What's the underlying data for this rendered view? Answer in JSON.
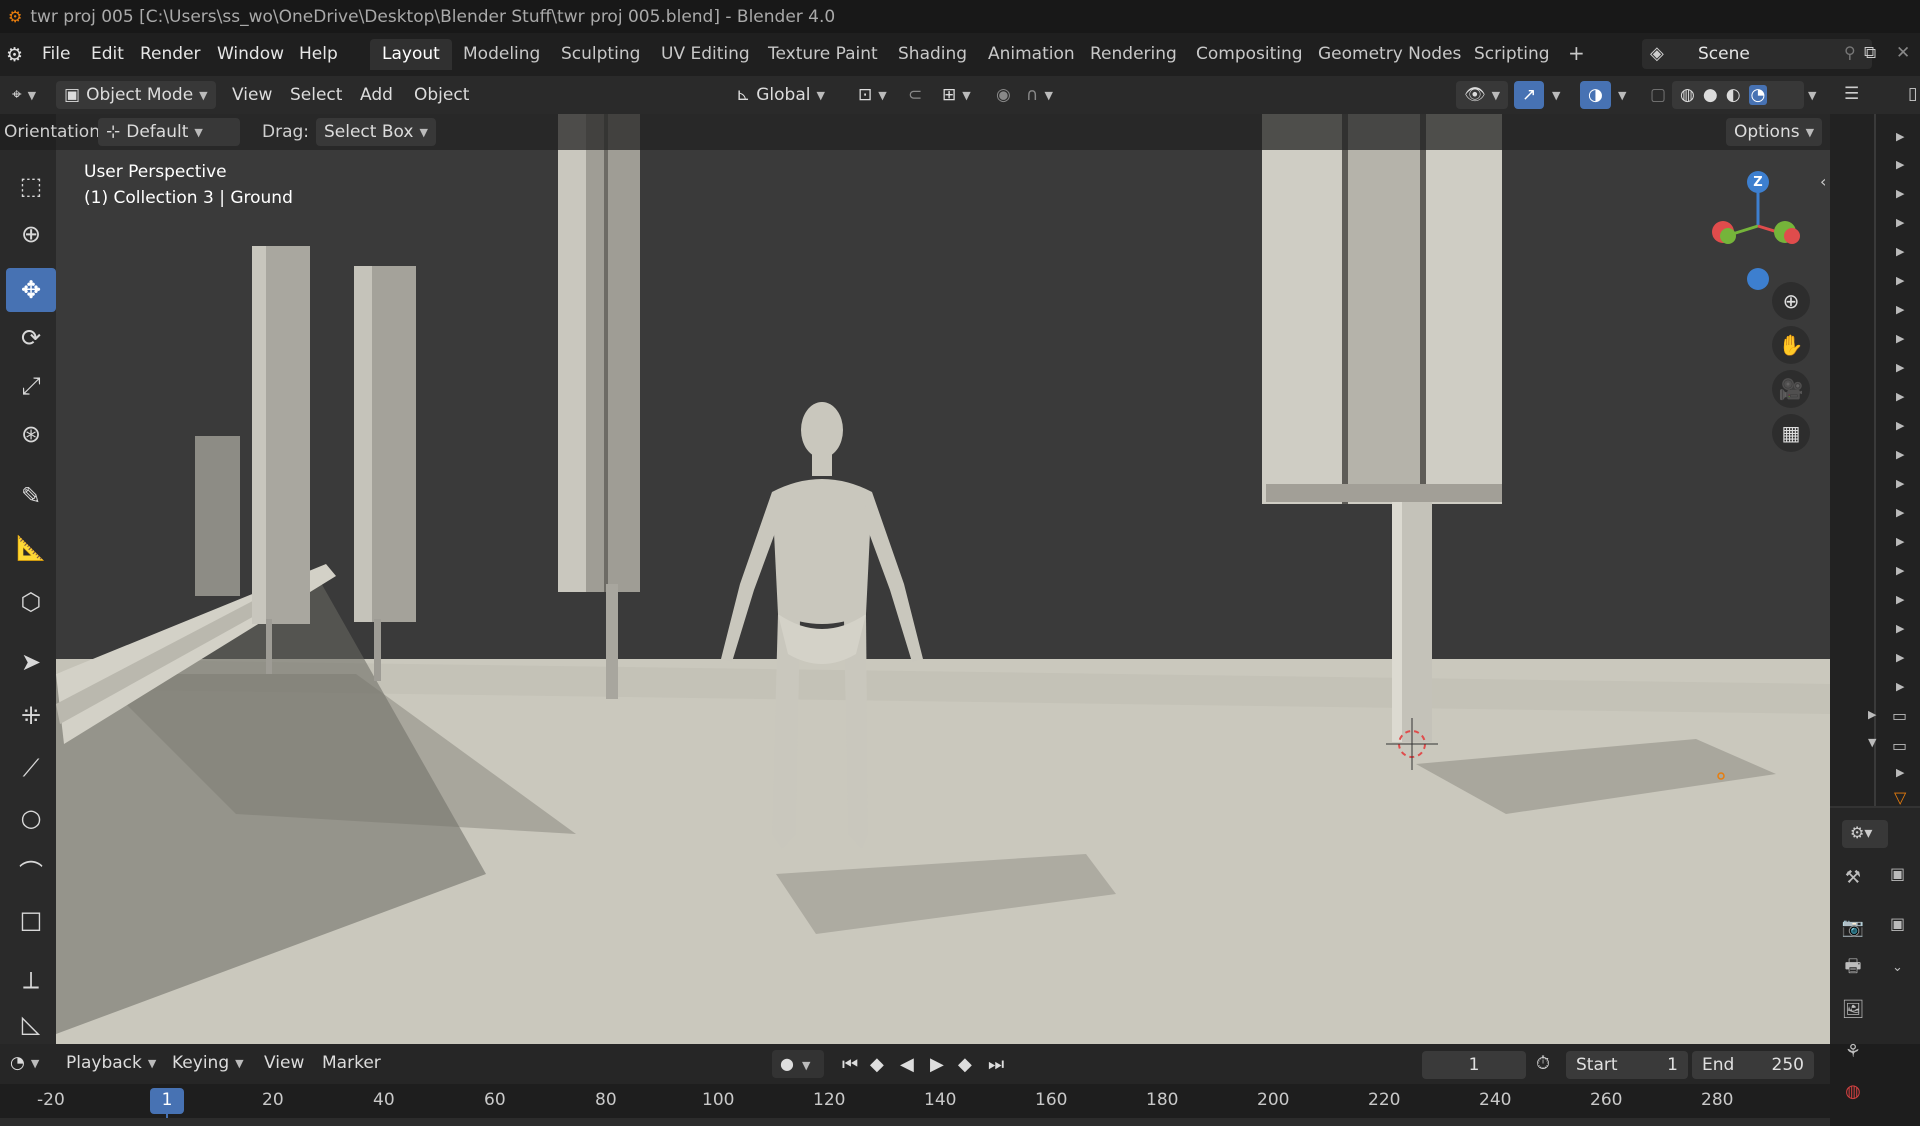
{
  "window": {
    "title": "twr proj 005 [C:\\Users\\ss_wo\\OneDrive\\Desktop\\Blender Stuff\\twr proj 005.blend] - Blender 4.0"
  },
  "menu": {
    "items": [
      "File",
      "Edit",
      "Render",
      "Window",
      "Help"
    ]
  },
  "workspaces": {
    "tabs": [
      "Layout",
      "Modeling",
      "Sculpting",
      "UV Editing",
      "Texture Paint",
      "Shading",
      "Animation",
      "Rendering",
      "Compositing",
      "Geometry Nodes",
      "Scripting"
    ],
    "active": "Layout",
    "add_symbol": "+"
  },
  "scene": {
    "name": "Scene"
  },
  "header": {
    "mode": "Object Mode",
    "menus": [
      "View",
      "Select",
      "Add",
      "Object"
    ],
    "transform_orientation": "Global"
  },
  "tool_options": {
    "orientation_label": "Orientation:",
    "orientation_value": "Default",
    "drag_label": "Drag:",
    "drag_value": "Select Box",
    "options_label": "Options"
  },
  "viewport": {
    "view_name": "User Perspective",
    "collection_info": "(1) Collection 3 | Ground",
    "gizmo_axis_label": "Z"
  },
  "toolbar": {
    "tools": [
      "select-box-icon",
      "cursor-icon",
      "move-icon",
      "rotate-icon",
      "scale-icon",
      "transform-icon",
      "annotate-icon",
      "measure-icon",
      "add-cube-icon",
      "select-tool-icon",
      "add-vertex-icon",
      "add-edge-icon",
      "add-circle-icon",
      "add-curve-icon",
      "add-plane-icon",
      "knife-icon",
      "add-shape-icon"
    ],
    "active": "move-icon"
  },
  "timeline": {
    "menus": [
      "Playback",
      "Keying",
      "View",
      "Marker"
    ],
    "current_frame": "1",
    "start_label": "Start",
    "start_value": "1",
    "end_label": "End",
    "end_value": "250",
    "ruler_ticks": [
      "-20",
      "1",
      "20",
      "40",
      "60",
      "80",
      "100",
      "120",
      "140",
      "160",
      "180",
      "200",
      "220",
      "240",
      "260",
      "280"
    ]
  },
  "colors": {
    "accent": "#4772b3",
    "axis_x": "#e04c4c",
    "axis_y": "#75b43a",
    "axis_z": "#3d7fcf",
    "ground": "#cfcdc2",
    "sky": "#3a3a3a",
    "blender_orange": "#e87d0d"
  }
}
